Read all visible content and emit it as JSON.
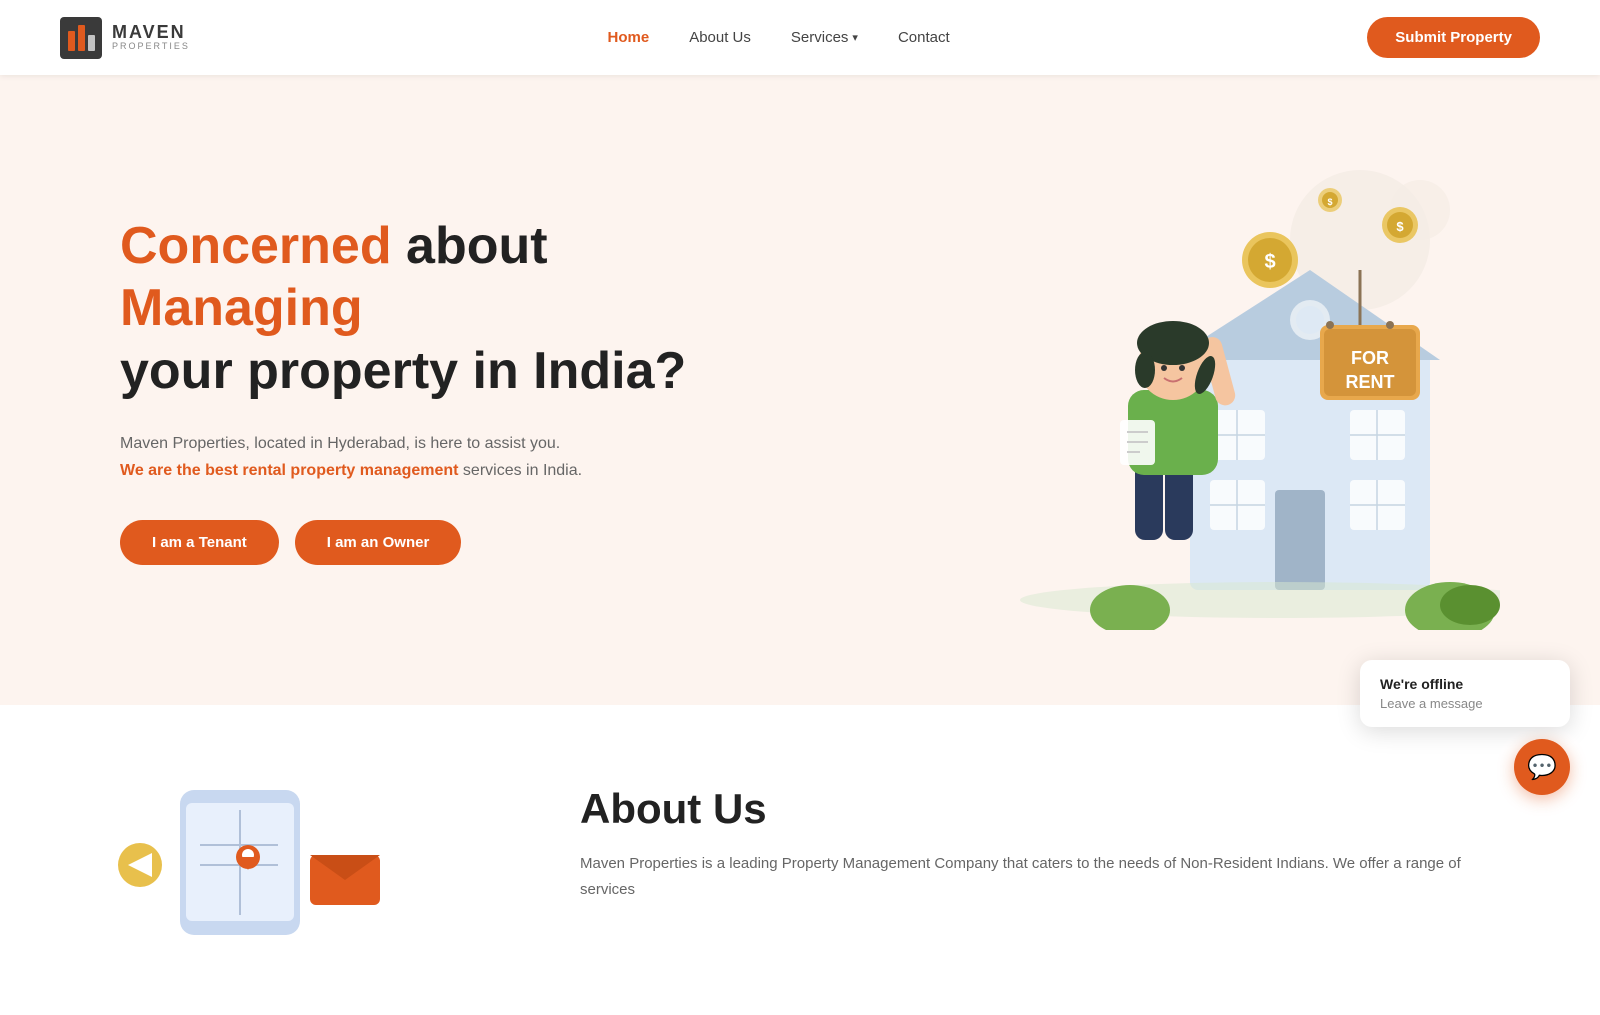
{
  "navbar": {
    "logo": {
      "maven": "MAVEN",
      "properties": "PROPERTIES"
    },
    "links": [
      {
        "id": "home",
        "label": "Home",
        "active": true
      },
      {
        "id": "about",
        "label": "About Us",
        "active": false
      },
      {
        "id": "services",
        "label": "Services",
        "active": false,
        "hasDropdown": true
      },
      {
        "id": "contact",
        "label": "Contact",
        "active": false
      }
    ],
    "submit_button": "Submit Property"
  },
  "hero": {
    "title_line1_part1": "Concerned",
    "title_line1_part2": " about ",
    "title_line1_part3": "Managing",
    "title_line2": "your property in India?",
    "desc_line1": "Maven Properties, located in Hyderabad, is here to assist you.",
    "desc_highlight": "We are the best rental property management",
    "desc_line2": " services in India.",
    "btn_tenant": "I am a Tenant",
    "btn_owner": "I am an Owner"
  },
  "about": {
    "title": "About Us",
    "text": "Maven Properties is a leading Property Management Company that caters to the needs of Non-Resident Indians. We offer a range of services"
  },
  "chat": {
    "offline_label": "We're offline",
    "message_label": "Leave a message",
    "icon": "💬"
  }
}
